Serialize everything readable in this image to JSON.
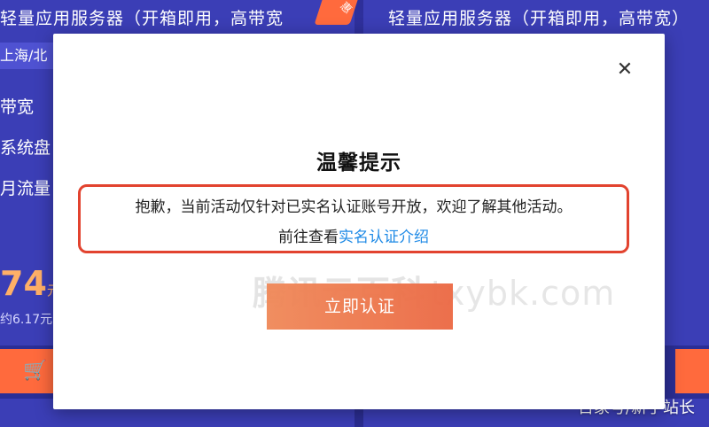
{
  "background": {
    "left_card": {
      "title": "轻量应用服务器（开箱即用，高带宽",
      "ribbon": "惠",
      "region": "上海/北",
      "specs": [
        "带宽",
        "系统盘",
        "月流量"
      ],
      "price": "74",
      "price_unit": "元",
      "per_month": "约6.17元"
    },
    "right_card": {
      "title": "轻量应用服务器（开箱即用，高带宽）"
    },
    "footer_text": "百家号/新手站长"
  },
  "modal": {
    "title": "温馨提示",
    "message_line1": "抱歉，当前活动仅针对已实名认证账号开放，欢迎了解其他活动。",
    "message_line2_prefix": "前往查看",
    "message_link": "实名认证介绍",
    "confirm_label": "立即认证",
    "close_symbol": "✕"
  },
  "watermark": {
    "cn": "腾讯云百科",
    "en": "txybk.com"
  },
  "colors": {
    "accent": "#ec6a45",
    "link": "#1e8ae6",
    "highlight_border": "#e2432f",
    "background": "#3b3eb6"
  }
}
